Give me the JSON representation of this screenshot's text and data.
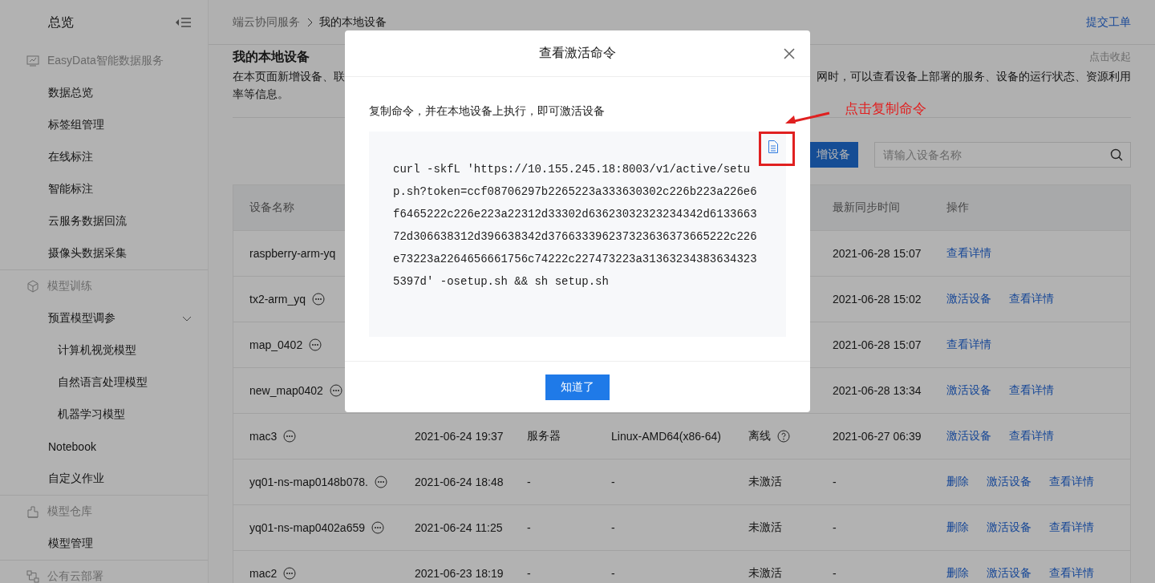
{
  "sidebar": {
    "title": "总览",
    "groups": [
      {
        "label": "EasyData智能数据服务",
        "items": [
          {
            "label": "数据总览"
          },
          {
            "label": "标签组管理"
          },
          {
            "label": "在线标注"
          },
          {
            "label": "智能标注"
          },
          {
            "label": "云服务数据回流"
          },
          {
            "label": "摄像头数据采集"
          }
        ]
      },
      {
        "label": "模型训练",
        "items": [
          {
            "label": "预置模型调参",
            "expanded": true,
            "children": [
              {
                "label": "计算机视觉模型"
              },
              {
                "label": "自然语言处理模型"
              },
              {
                "label": "机器学习模型"
              }
            ]
          },
          {
            "label": "Notebook"
          },
          {
            "label": "自定义作业"
          }
        ]
      },
      {
        "label": "模型仓库",
        "items": [
          {
            "label": "模型管理"
          }
        ]
      },
      {
        "label": "公有云部署"
      }
    ]
  },
  "header": {
    "breadcrumb": [
      "端云协同服务",
      "我的本地设备"
    ],
    "link": "提交工单"
  },
  "page": {
    "heading": "我的本地设备",
    "collapse_link": "点击收起",
    "description_left": "在本页面新增设备、联",
    "description_right": "网时，可以查看设备上部署的服务、设备的运行状态、资源利用",
    "description_line2": "率等信息。",
    "add_button": "增设备",
    "search": {
      "placeholder": "请输入设备名称"
    }
  },
  "table": {
    "columns": [
      {
        "label": "设备名称"
      },
      {},
      {},
      {},
      {},
      {
        "label": "最新同步时间"
      },
      {
        "label": "操作"
      }
    ],
    "rows": [
      {
        "name": "raspberry-arm-yq",
        "more": false,
        "synced": "2021-06-28 15:07",
        "actions": [
          "查看详情"
        ]
      },
      {
        "name": "tx2-arm_yq",
        "more": true,
        "synced": "2021-06-28 15:02",
        "actions": [
          "激活设备",
          "查看详情"
        ]
      },
      {
        "name": "map_0402",
        "more": true,
        "synced": "2021-06-28 15:07",
        "actions": [
          "查看详情"
        ]
      },
      {
        "name": "new_map0402",
        "more": true,
        "synced": "2021-06-28 13:34",
        "actions": [
          "激活设备",
          "查看详情"
        ]
      },
      {
        "name": "mac3",
        "more": true,
        "created": "2021-06-24 19:37",
        "type": "服务器",
        "os": "Linux-AMD64(x86-64)",
        "status": "离线",
        "status_help": true,
        "synced": "2021-06-27 06:39",
        "actions": [
          "激活设备",
          "查看详情"
        ]
      },
      {
        "name": "yq01-ns-map0148b078.",
        "more": true,
        "created": "2021-06-24 18:48",
        "type": "-",
        "os": "-",
        "status": "未激活",
        "status_help": false,
        "synced": "-",
        "actions": [
          "删除",
          "激活设备",
          "查看详情"
        ]
      },
      {
        "name": "yq01-ns-map0402a659",
        "more": true,
        "created": "2021-06-24 11:25",
        "type": "-",
        "os": "-",
        "status": "未激活",
        "status_help": false,
        "synced": "-",
        "actions": [
          "删除",
          "激活设备",
          "查看详情"
        ]
      },
      {
        "name": "mac2",
        "more": true,
        "created": "2021-06-23 18:19",
        "type": "-",
        "os": "-",
        "status": "未激活",
        "status_help": false,
        "synced": "-",
        "actions": [
          "删除",
          "激活设备",
          "查看详情"
        ]
      }
    ]
  },
  "modal": {
    "title": "查看激活命令",
    "instruction": "复制命令，并在本地设备上执行，即可激活设备",
    "code_lines": [
      "curl -skfL 'https://10.155.245.18:8003/v1/active/setu",
      "p.sh?token=ccf08706297b2265223a333630302c226b223a226e6",
      "f6465222c226e223a22312d33302d63623032323234342d6133663",
      "72d306638312d396638342d376633396237323636373665222c226",
      "e73223a2264656661756c74222c227473223a31363234383634323",
      "5397d' -osetup.sh && sh setup.sh"
    ],
    "ok_button": "知道了"
  },
  "annotation": {
    "text": "点击复制命令"
  }
}
